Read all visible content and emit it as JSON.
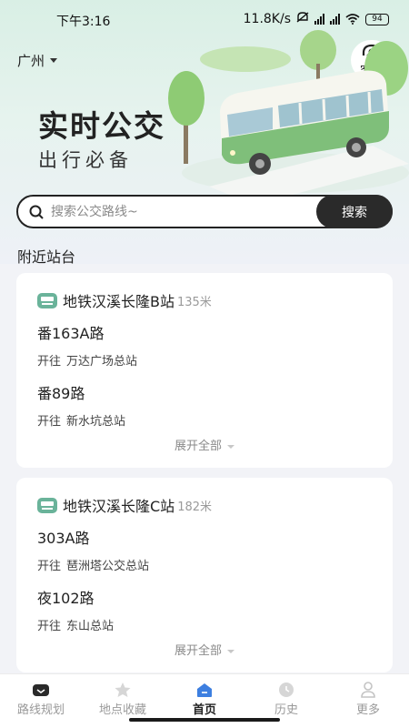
{
  "status": {
    "time": "下午3:16",
    "net_speed": "11.8K/s",
    "battery": "94"
  },
  "header": {
    "city": "广州",
    "service_label": "客服"
  },
  "hero": {
    "title": "实时公交",
    "subtitle": "出行必备"
  },
  "search": {
    "placeholder": "搜索公交路线~",
    "button_label": "搜索"
  },
  "nearby": {
    "title": "附近站台",
    "dir_prefix": "开往",
    "expand_label": "展开全部",
    "stops": [
      {
        "name": "地铁汉溪长隆B站",
        "distance": "135米",
        "routes": [
          {
            "name": "番163A路",
            "destination": "万达广场总站"
          },
          {
            "name": "番89路",
            "destination": "新水坑总站"
          }
        ]
      },
      {
        "name": "地铁汉溪长隆C站",
        "distance": "182米",
        "routes": [
          {
            "name": "303A路",
            "destination": "琶洲塔公交总站"
          },
          {
            "name": "夜102路",
            "destination": "东山总站"
          }
        ]
      }
    ]
  },
  "tabs": [
    {
      "label": "路线规划",
      "icon": "route-plan-icon"
    },
    {
      "label": "地点收藏",
      "icon": "favorite-icon"
    },
    {
      "label": "首页",
      "icon": "home-icon",
      "active": true
    },
    {
      "label": "历史",
      "icon": "history-icon"
    },
    {
      "label": "更多",
      "icon": "more-icon"
    }
  ],
  "colors": {
    "accent": "#6ab39a",
    "bus_green": "#7fbf7a",
    "dark": "#2a2a2a"
  }
}
